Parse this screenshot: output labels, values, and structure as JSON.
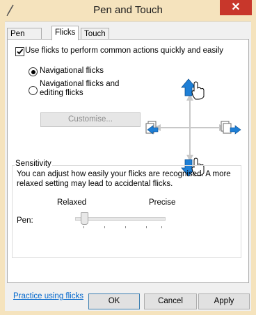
{
  "window": {
    "title": "Pen and Touch",
    "title_icon": "pen-icon",
    "close_glyph": "✕"
  },
  "tabs": [
    {
      "label": "Pen Options",
      "active": false
    },
    {
      "label": "Flicks",
      "active": true
    },
    {
      "label": "Touch",
      "active": false
    }
  ],
  "flicks": {
    "enable_checkbox": {
      "label": "Use flicks to perform common actions quickly and easily",
      "checked": true
    },
    "radios": [
      {
        "label": "Navigational flicks",
        "selected": true
      },
      {
        "label_line1": "Navigational flicks and",
        "label_line2": "editing flicks",
        "selected": false
      }
    ],
    "customise_button": "Customise...",
    "diagram_icons": [
      "flick-up-arrow-icon",
      "flick-down-arrow-icon",
      "flick-left-arrow-icon",
      "flick-right-arrow-icon",
      "hand-cursor-icon"
    ]
  },
  "sensitivity": {
    "legend": "Sensitivity",
    "description_line1": "You can adjust how easily your flicks are recognised. A more",
    "description_line2": "relaxed setting may lead to accidental flicks.",
    "relaxed_label": "Relaxed",
    "precise_label": "Precise",
    "pen_label": "Pen:",
    "slider_level": 0
  },
  "practice_link": "Practice using flicks",
  "buttons": {
    "ok": "OK",
    "cancel": "Cancel",
    "apply": "Apply"
  },
  "colors": {
    "title_bar": "#f5e3bd",
    "close_button": "#c8372b",
    "link": "#0066cc",
    "arrow_blue": "#1e7fd6"
  }
}
